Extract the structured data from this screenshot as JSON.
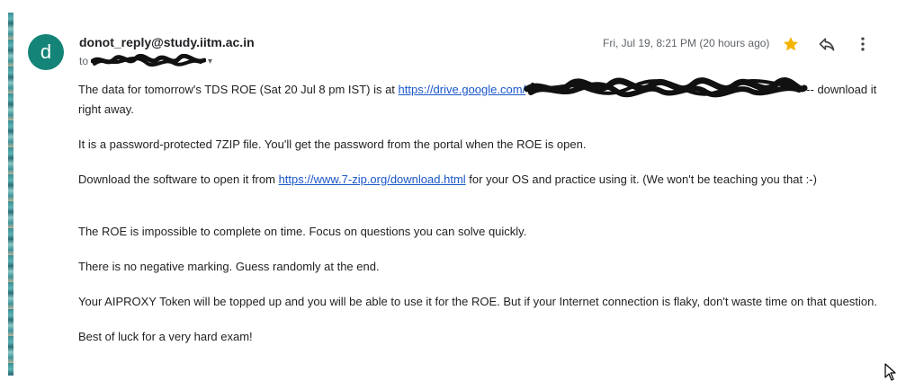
{
  "sender": {
    "avatar_letter": "d",
    "email": "donot_reply@study.iitm.ac.in",
    "to_label": "to"
  },
  "date": "Fri, Jul 19, 8:21 PM (20 hours ago)",
  "actions": {
    "star": "star-icon",
    "reply": "reply-icon",
    "more": "more-icon"
  },
  "colors": {
    "avatar_bg": "#138477",
    "link": "#1a56c8",
    "star": "#f4b400"
  },
  "message": {
    "p1_before": "The data for tomorrow's TDS ROE (Sat 20 Jul 8 pm IST) is at ",
    "p1_link": "https://drive.google.com/",
    "p1_after": "-- download it right away.",
    "p2": "It is a password-protected 7ZIP file. You'll get the password from the portal when the ROE is open.",
    "p3_before": "Download the software to open it from ",
    "p3_link": "https://www.7-zip.org/download.html",
    "p3_after": " for your OS and practice using it. (We won't be teaching you that :-)",
    "p4": "The ROE is impossible to complete on time. Focus on questions you can solve quickly.",
    "p5": "There is no negative marking. Guess randomly at the end.",
    "p6": "Your AIPROXY Token will be topped up and you will be able to use it for the ROE. But if your Internet connection is flaky, don't waste time on that question.",
    "p7": "Best of luck for a very hard exam!"
  }
}
